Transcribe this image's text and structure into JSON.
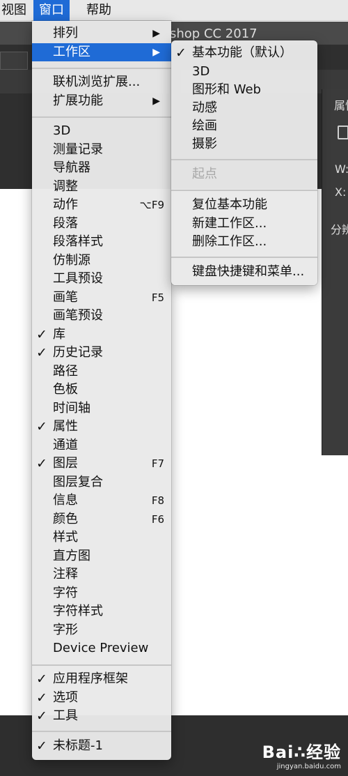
{
  "menubar": {
    "view": "视图",
    "window": "窗口",
    "help": "帮助"
  },
  "app": {
    "title": "shop CC 2017",
    "panel_title": "属性",
    "panel_w": "W:",
    "panel_x": "X:",
    "panel_fen": "分辨"
  },
  "main_menu": {
    "arrange": "排列",
    "workspace": "工作区",
    "browse_extensions": "联机浏览扩展...",
    "extensions": "扩展功能",
    "items": [
      {
        "label": "3D",
        "check": "",
        "shortcut": ""
      },
      {
        "label": "测量记录",
        "check": "",
        "shortcut": ""
      },
      {
        "label": "导航器",
        "check": "",
        "shortcut": ""
      },
      {
        "label": "调整",
        "check": "",
        "shortcut": ""
      },
      {
        "label": "动作",
        "check": "",
        "shortcut": "⌥F9"
      },
      {
        "label": "段落",
        "check": "",
        "shortcut": ""
      },
      {
        "label": "段落样式",
        "check": "",
        "shortcut": ""
      },
      {
        "label": "仿制源",
        "check": "",
        "shortcut": ""
      },
      {
        "label": "工具预设",
        "check": "",
        "shortcut": ""
      },
      {
        "label": "画笔",
        "check": "",
        "shortcut": "F5"
      },
      {
        "label": "画笔预设",
        "check": "",
        "shortcut": ""
      },
      {
        "label": "库",
        "check": "✓",
        "shortcut": ""
      },
      {
        "label": "历史记录",
        "check": "✓",
        "shortcut": ""
      },
      {
        "label": "路径",
        "check": "",
        "shortcut": ""
      },
      {
        "label": "色板",
        "check": "",
        "shortcut": ""
      },
      {
        "label": "时间轴",
        "check": "",
        "shortcut": ""
      },
      {
        "label": "属性",
        "check": "✓",
        "shortcut": ""
      },
      {
        "label": "通道",
        "check": "",
        "shortcut": ""
      },
      {
        "label": "图层",
        "check": "✓",
        "shortcut": "F7"
      },
      {
        "label": "图层复合",
        "check": "",
        "shortcut": ""
      },
      {
        "label": "信息",
        "check": "",
        "shortcut": "F8"
      },
      {
        "label": "颜色",
        "check": "",
        "shortcut": "F6"
      },
      {
        "label": "样式",
        "check": "",
        "shortcut": ""
      },
      {
        "label": "直方图",
        "check": "",
        "shortcut": ""
      },
      {
        "label": "注释",
        "check": "",
        "shortcut": ""
      },
      {
        "label": "字符",
        "check": "",
        "shortcut": ""
      },
      {
        "label": "字符样式",
        "check": "",
        "shortcut": ""
      },
      {
        "label": "字形",
        "check": "",
        "shortcut": ""
      },
      {
        "label": "Device Preview",
        "check": "",
        "shortcut": ""
      }
    ],
    "options_items": [
      {
        "label": "应用程序框架",
        "check": "✓"
      },
      {
        "label": "选项",
        "check": "✓"
      },
      {
        "label": "工具",
        "check": "✓"
      }
    ],
    "document": {
      "label": "未标题-1",
      "check": "✓"
    }
  },
  "workspace_submenu": {
    "essentials": "基本功能（默认）",
    "essentials_check": "✓",
    "threed": "3D",
    "graphic_web": "图形和 Web",
    "motion": "动感",
    "painting": "绘画",
    "photography": "摄影",
    "starting_point": "起点",
    "reset": "复位基本功能",
    "new_workspace": "新建工作区...",
    "delete_workspace": "删除工作区...",
    "shortcuts_menus": "键盘快捷键和菜单..."
  },
  "watermark": {
    "logo": "Bai∴经验",
    "url": "jingyan.baidu.com"
  },
  "colors": {
    "highlight": "#1f6bd6",
    "menu_bg": "#e9e9e9",
    "app_dark": "#2f2f2f"
  },
  "icons": {
    "check": "checkmark-icon",
    "submenu_arrow": "triangle-right-icon"
  }
}
